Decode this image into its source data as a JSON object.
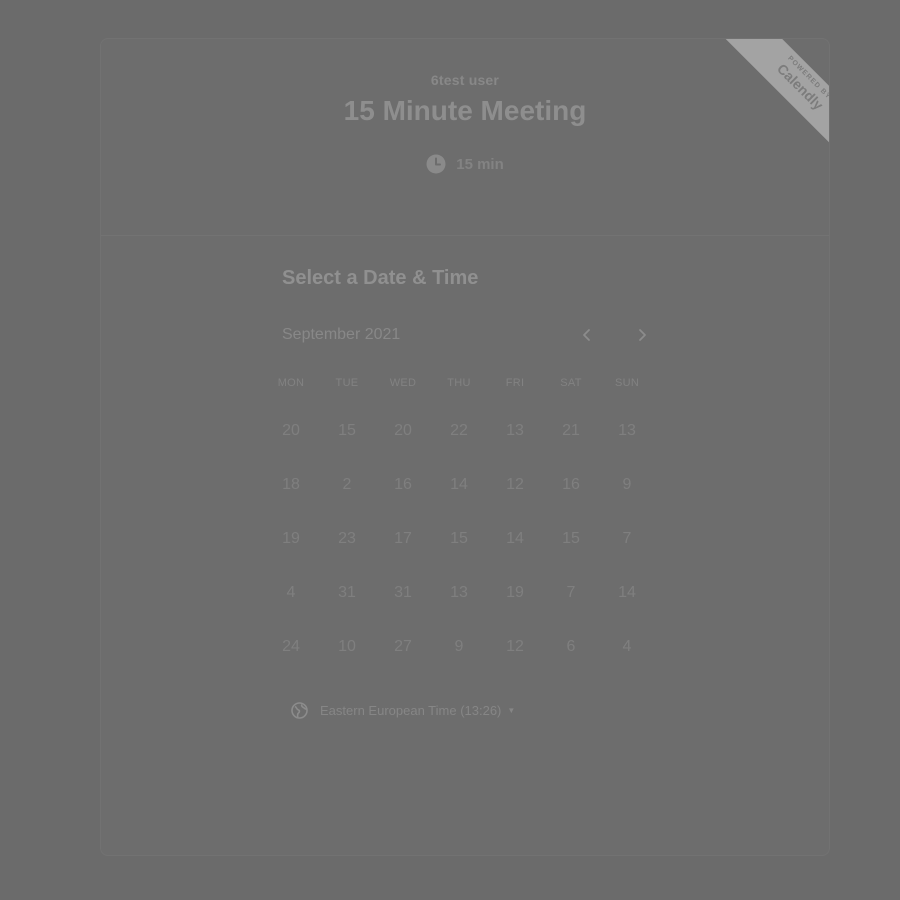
{
  "header": {
    "user_name": "6test user",
    "event_title": "15 Minute Meeting",
    "duration": "15 min",
    "duration_icon": "clock-icon"
  },
  "ribbon": {
    "powered_by": "POWERED BY",
    "brand": "Calendly"
  },
  "scheduler": {
    "section_title": "Select a Date & Time",
    "month_label": "September 2021",
    "prev_icon": "chevron-left-icon",
    "next_icon": "chevron-right-icon",
    "weekdays": [
      "MON",
      "TUE",
      "WED",
      "THU",
      "FRI",
      "SAT",
      "SUN"
    ],
    "days": [
      [
        "20",
        "15",
        "20",
        "22",
        "13",
        "21",
        "13"
      ],
      [
        "18",
        "2",
        "16",
        "14",
        "12",
        "16",
        "9"
      ],
      [
        "19",
        "23",
        "17",
        "15",
        "14",
        "15",
        "7"
      ],
      [
        "4",
        "31",
        "31",
        "13",
        "19",
        "7",
        "14"
      ],
      [
        "24",
        "10",
        "27",
        "9",
        "12",
        "6",
        "4"
      ]
    ]
  },
  "timezone": {
    "icon": "globe-icon",
    "label": "Eastern European Time (13:26)",
    "caret": "▼"
  },
  "colors": {
    "background": "#6b6b6b",
    "text": "#8e8e8e",
    "ribbon": "#a3a3a3"
  }
}
